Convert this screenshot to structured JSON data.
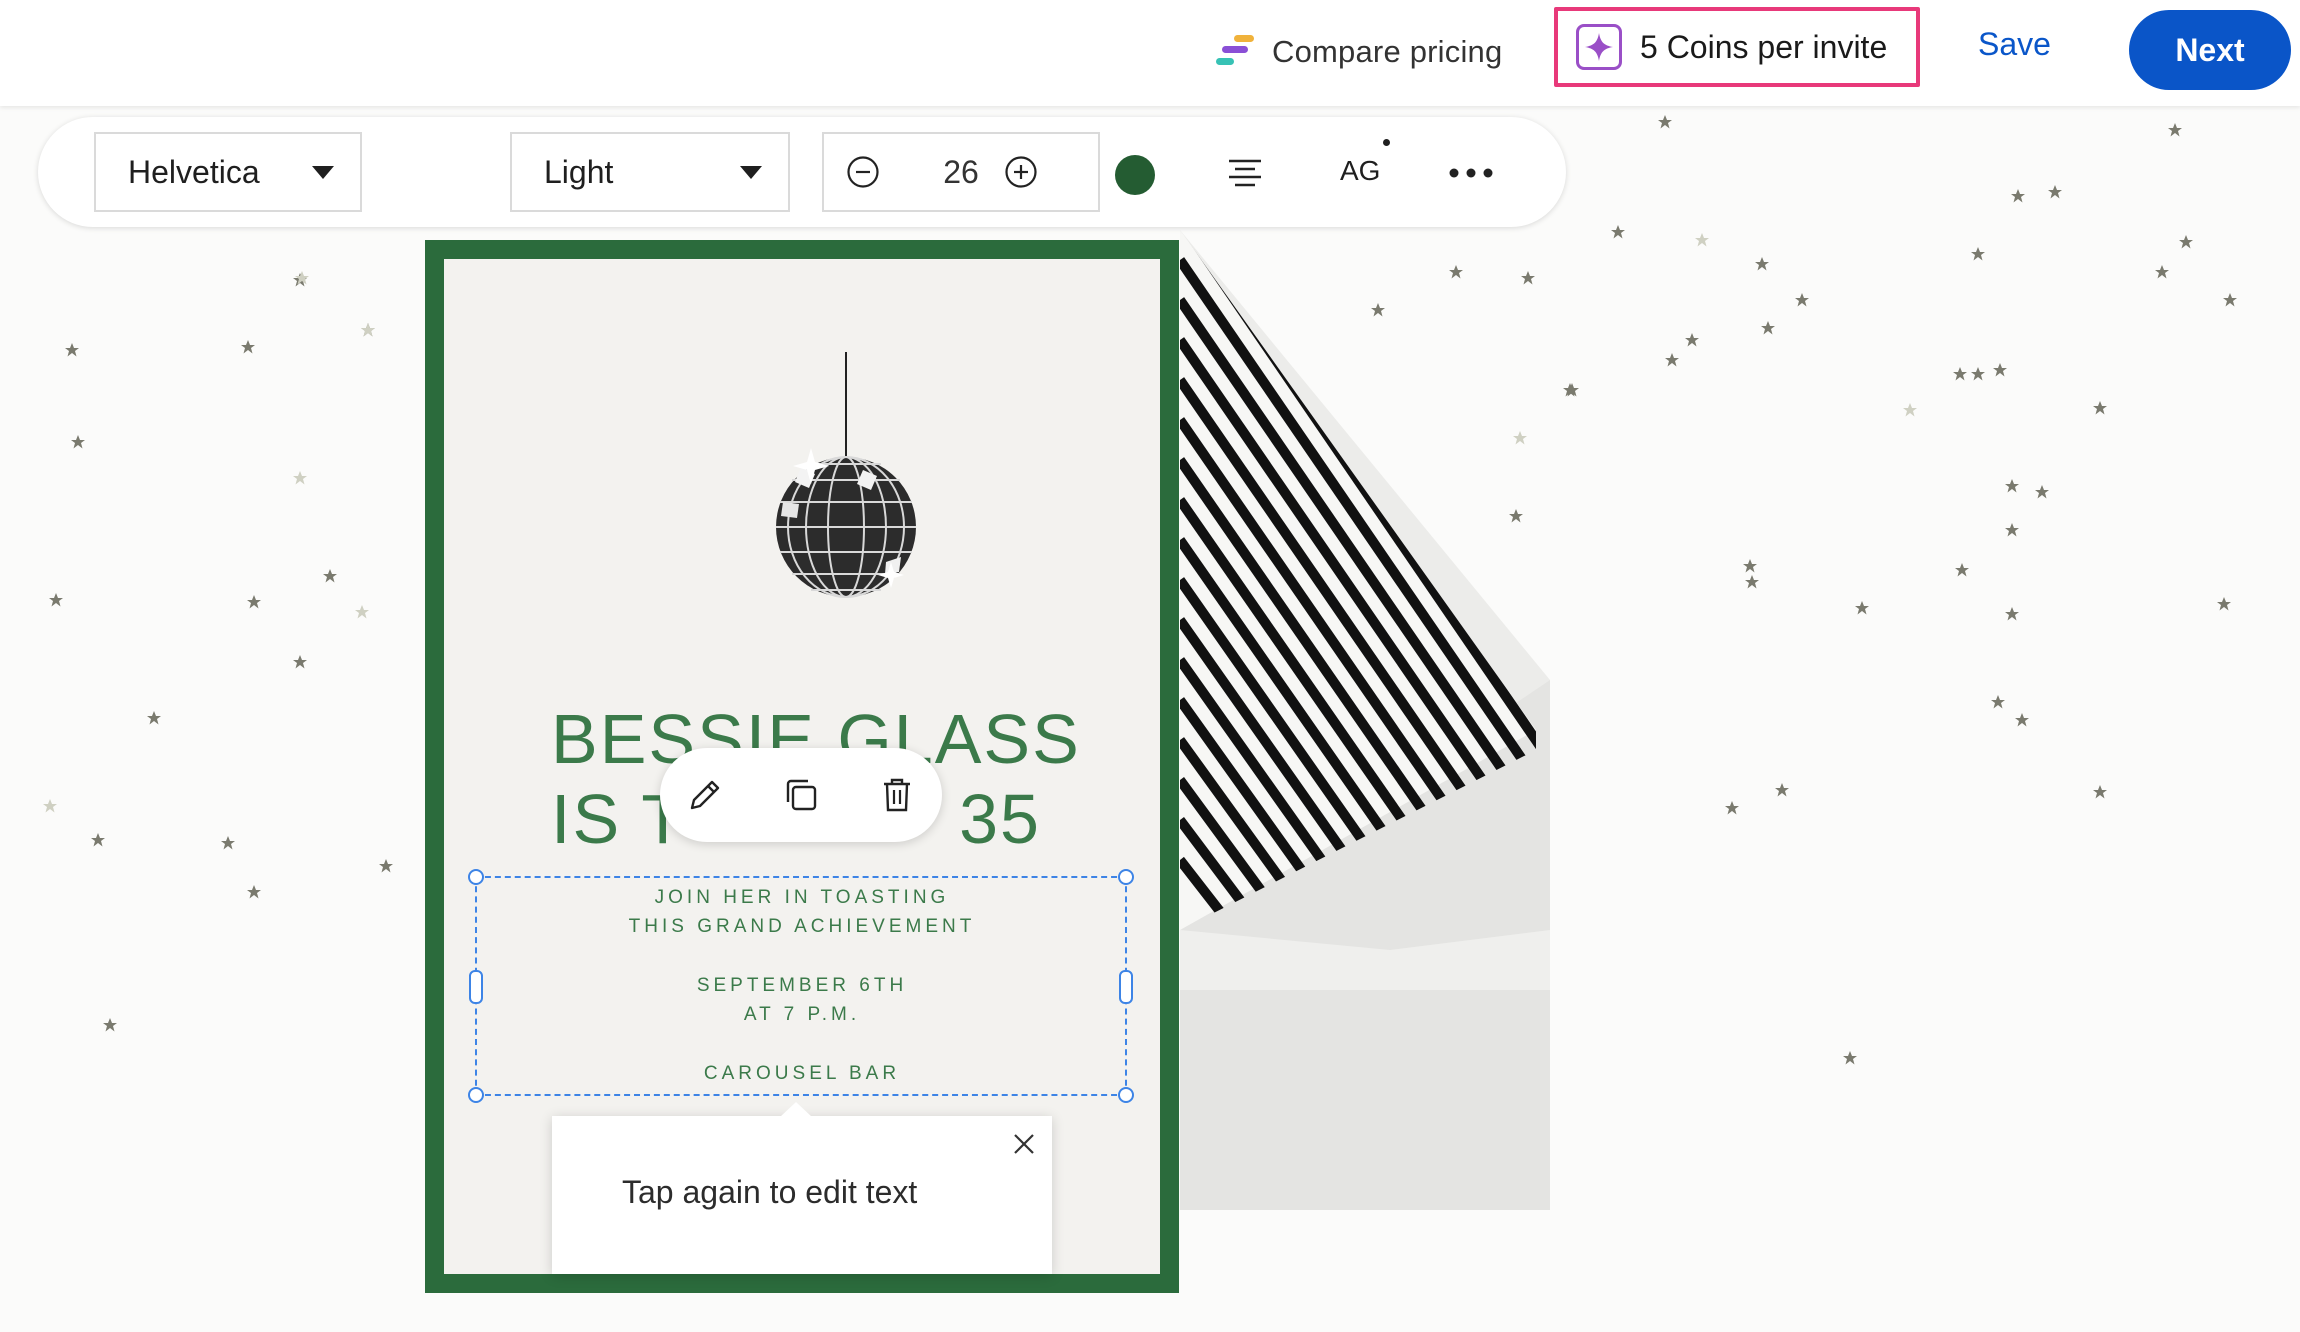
{
  "header": {
    "compare_pricing_label": "Compare pricing",
    "coins_label": "5 Coins per invite",
    "save_label": "Save",
    "next_label": "Next"
  },
  "toolbar": {
    "font_family_value": "Helvetica",
    "font_weight_value": "Light",
    "font_size_value": "26",
    "text_color": "#245c32",
    "case_label": "AG"
  },
  "card": {
    "headline_line1": "BESSIE GLASS",
    "headline_line2_start": "IS T",
    "headline_line2_end": "35",
    "body_lines": [
      "JOIN HER IN TOASTING",
      "THIS GRAND ACHIEVEMENT",
      "SEPTEMBER 6TH",
      "AT 7 P.M.",
      "CAROUSEL BAR"
    ],
    "frame_color": "#2b6b3c",
    "text_color": "#3b7a4a"
  },
  "tooltip": {
    "text": "Tap again to edit text"
  },
  "colors": {
    "accent": "#0a55c8",
    "highlight": "#e8397a",
    "selection": "#3d84e6"
  }
}
